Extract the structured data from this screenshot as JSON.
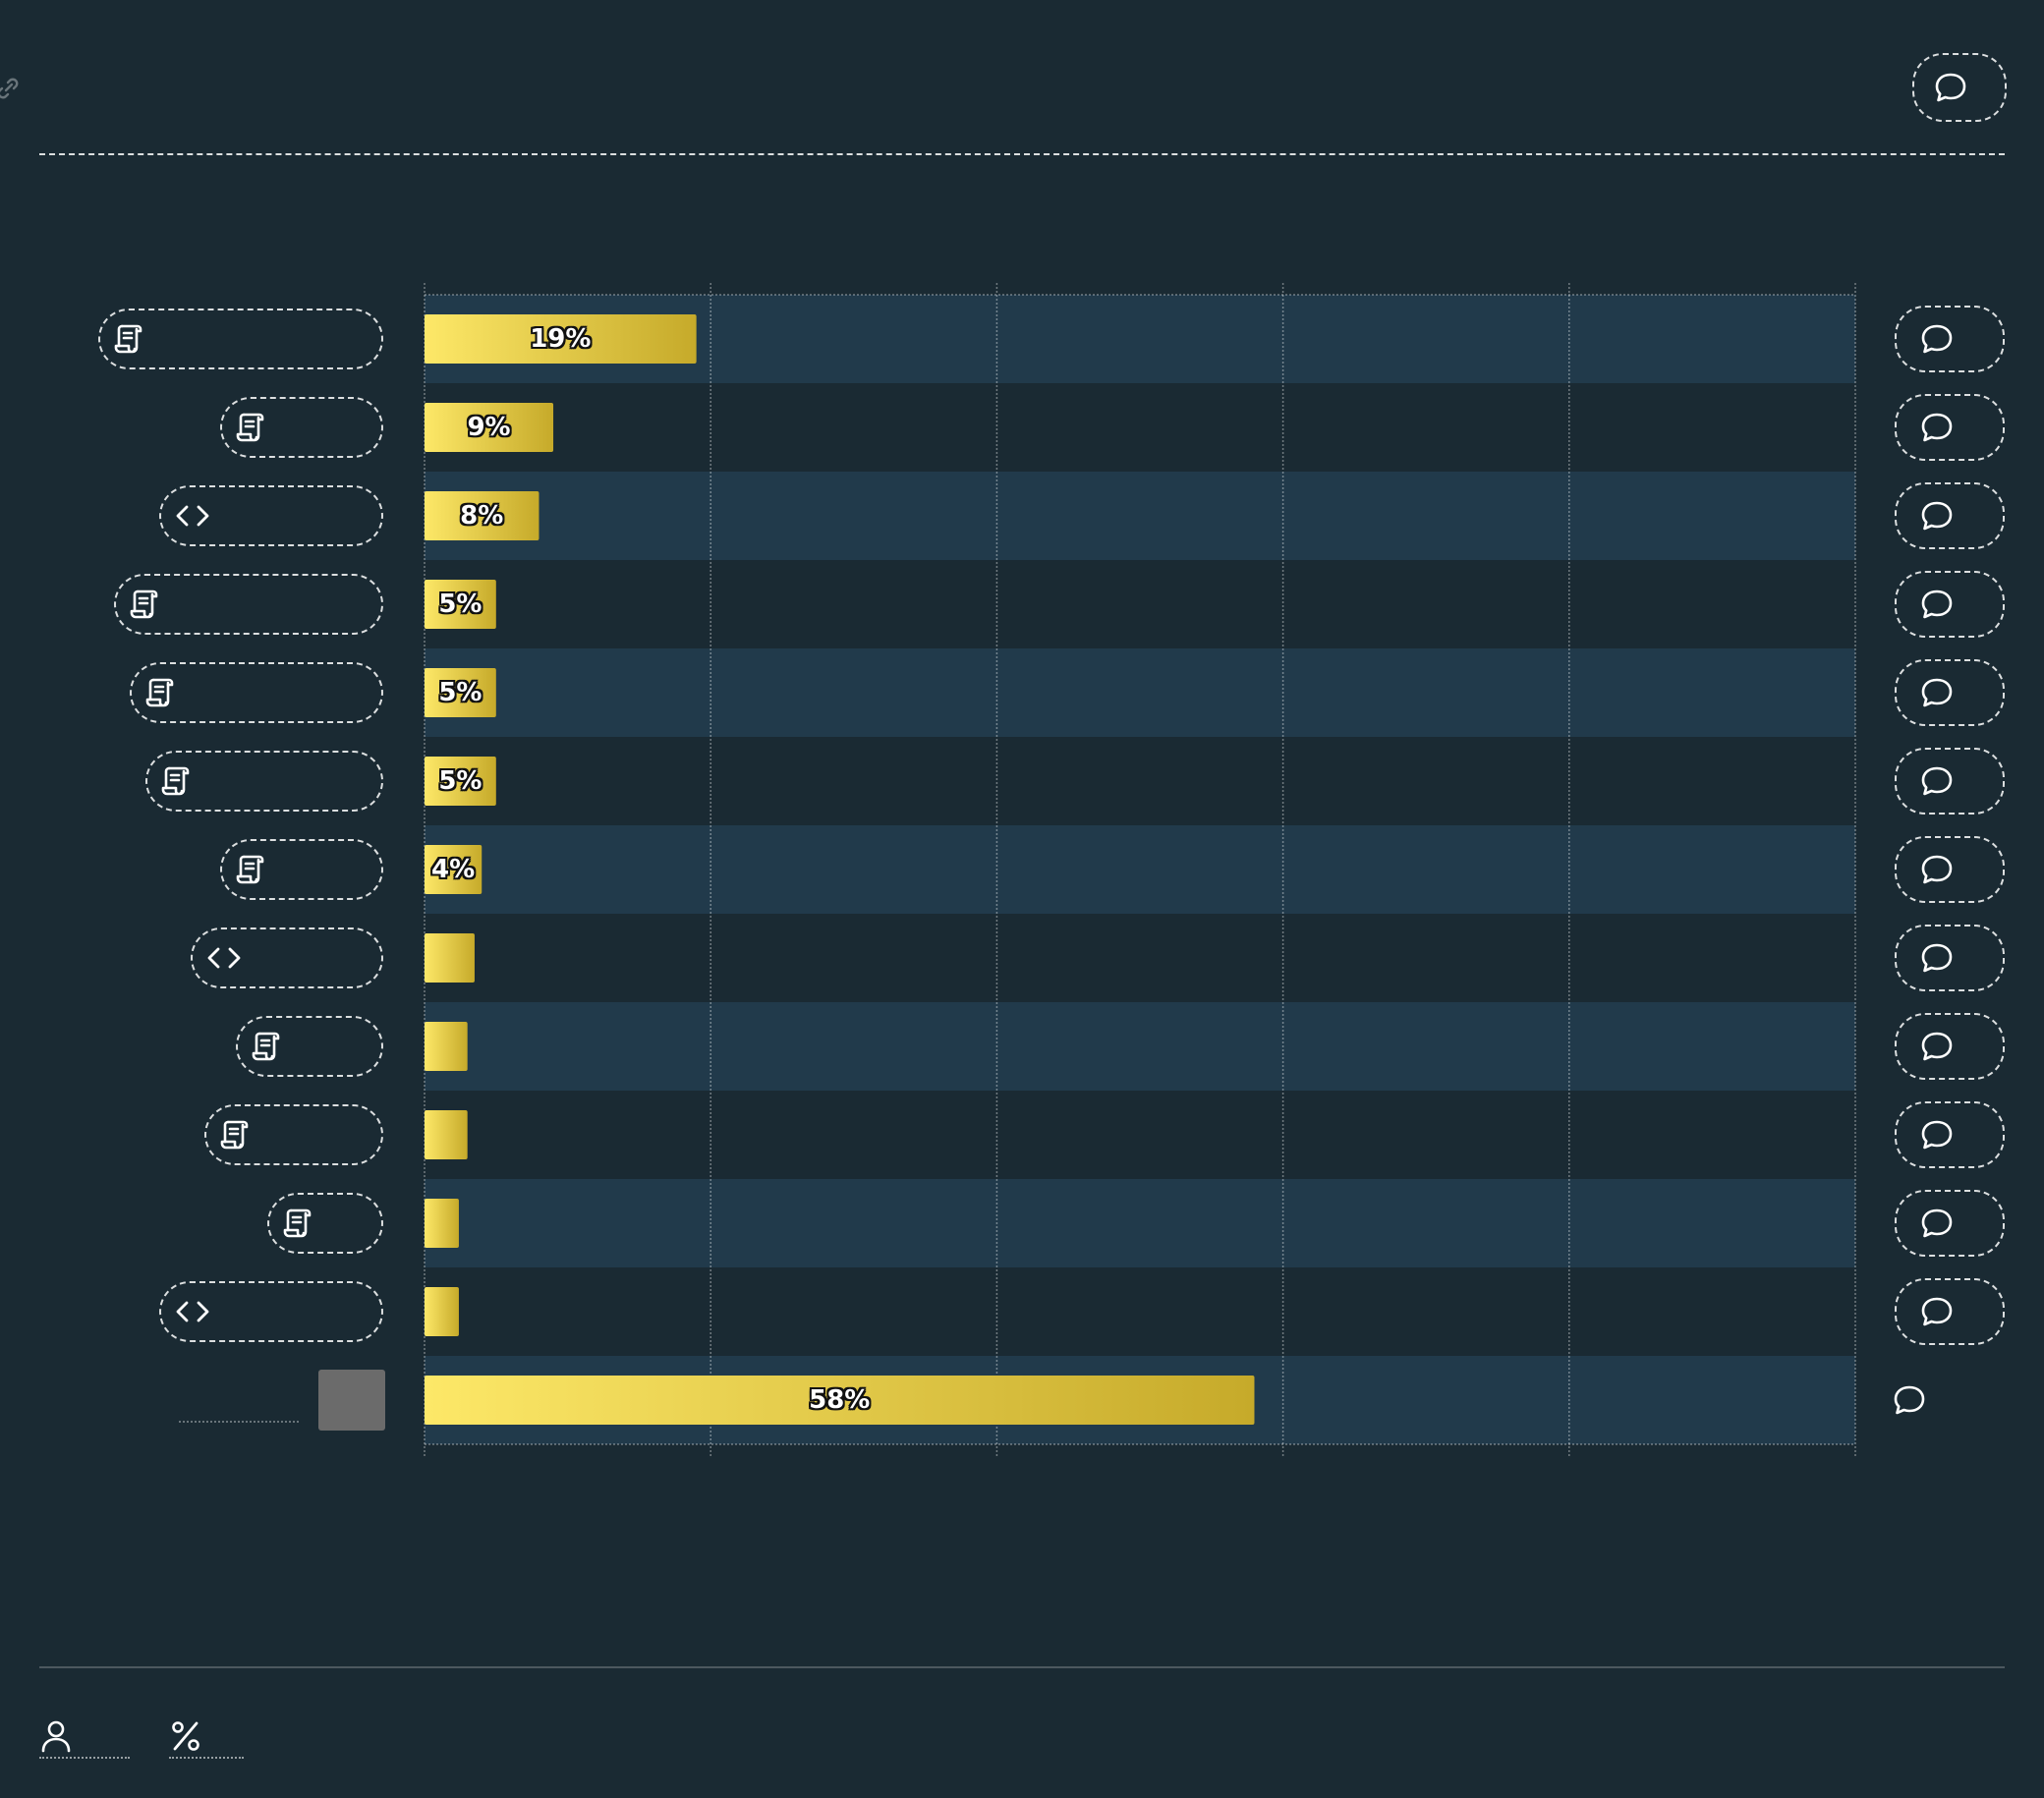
{
  "colors": {
    "background": "#1a2a33",
    "row_band": "#213a4b",
    "bar_start": "#fde868",
    "bar_end": "#c6aa2a",
    "other_swatch": "#6b6b6b"
  },
  "header": {
    "link_icon": "link-icon",
    "comment_icon": "comment-icon"
  },
  "footer": {
    "items": [
      {
        "icon": "user-icon"
      },
      {
        "icon": "percent-icon"
      }
    ]
  },
  "chart_data": {
    "type": "bar",
    "orientation": "horizontal",
    "categories": [
      "",
      "",
      "",
      "",
      "",
      "",
      "",
      "",
      "",
      "",
      "",
      "",
      ""
    ],
    "category_icons": [
      "scroll-icon",
      "scroll-icon",
      "code-icon",
      "scroll-icon",
      "scroll-icon",
      "scroll-icon",
      "scroll-icon",
      "code-icon",
      "scroll-icon",
      "scroll-icon",
      "scroll-icon",
      "code-icon",
      "other-swatch"
    ],
    "values": [
      19,
      9,
      8,
      5,
      5,
      5,
      4,
      3.5,
      3,
      3,
      2.4,
      2.4,
      58
    ],
    "data_labels": [
      "19%",
      "9%",
      "8%",
      "5%",
      "5%",
      "5%",
      "4%",
      "",
      "",
      "",
      "",
      "",
      "58%"
    ],
    "xlim": [
      0,
      100
    ],
    "x_gridlines": [
      0,
      20,
      40,
      60,
      80,
      100
    ],
    "grid": true,
    "row_comment_icons": true,
    "title": "",
    "xlabel": "",
    "ylabel": ""
  }
}
